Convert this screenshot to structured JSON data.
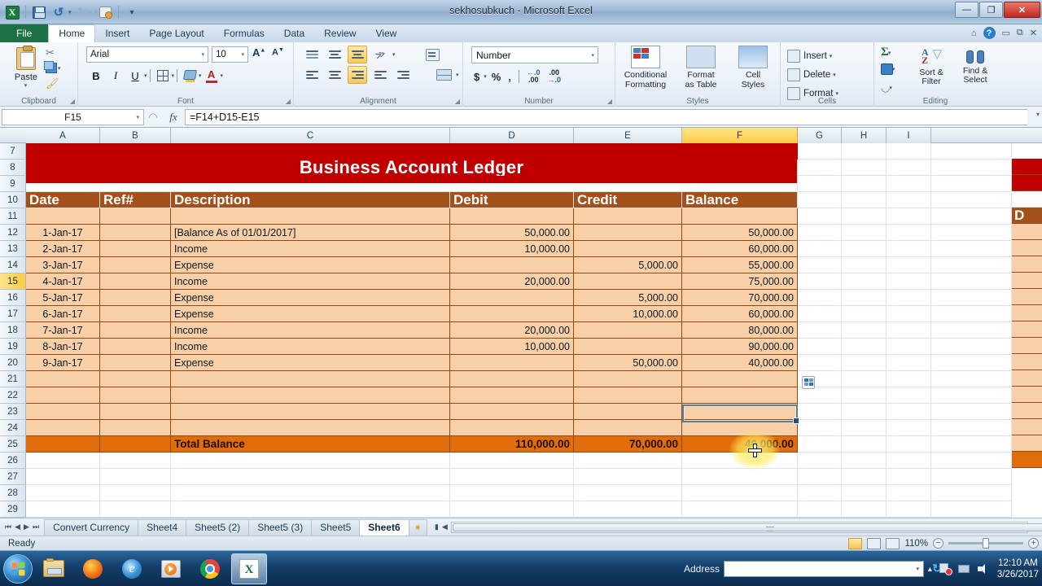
{
  "window": {
    "title": "sekhosubkuch - Microsoft Excel",
    "minimize": "—",
    "maximize": "❐",
    "close": "✕"
  },
  "quick_access": {
    "excel_logo": "X",
    "save": "save-icon",
    "undo": "↺",
    "redo": "↻",
    "print_preview": "print-preview-icon",
    "customize": "▾"
  },
  "ribbon": {
    "tabs": [
      {
        "label": "File",
        "active": false
      },
      {
        "label": "Home",
        "active": true
      },
      {
        "label": "Insert",
        "active": false
      },
      {
        "label": "Page Layout",
        "active": false
      },
      {
        "label": "Formulas",
        "active": false
      },
      {
        "label": "Data",
        "active": false
      },
      {
        "label": "Review",
        "active": false
      },
      {
        "label": "View",
        "active": false
      }
    ],
    "help_cluster": {
      "minimize_ribbon": "⌂",
      "help": "?",
      "restore_down": "▭",
      "window": "⧉",
      "close": "✕"
    },
    "groups": {
      "clipboard": {
        "label": "Clipboard",
        "paste": "Paste",
        "paste_caret": "▾",
        "cut": "✂",
        "copy": "copy-icon",
        "format_painter": "format-painter-icon",
        "dialog_launcher": "◢"
      },
      "font": {
        "label": "Font",
        "font_name": "Arial",
        "font_size": "10",
        "grow_font": "A",
        "shrink_font": "A",
        "bold": "B",
        "italic": "I",
        "underline": "U",
        "borders": "borders-icon",
        "fill_color": "fill-color-icon",
        "font_color": "A",
        "caret": "▾",
        "dialog_launcher": "◢"
      },
      "alignment": {
        "label": "Alignment",
        "top_align": "top-align-icon",
        "middle_align": "middle-align-icon",
        "bottom_align": "bottom-align-icon",
        "orientation": "orientation-icon",
        "align_left": "align-left-icon",
        "align_center": "align-center-icon",
        "align_right": "align-right-icon",
        "decrease_indent": "decrease-indent-icon",
        "increase_indent": "increase-indent-icon",
        "wrap_text": "wrap-text-icon",
        "merge_center": "merge-center-icon",
        "caret": "▾",
        "dialog_launcher": "◢"
      },
      "number": {
        "label": "Number",
        "format": "Number",
        "accounting": "$",
        "percent": "%",
        "comma": ",",
        "increase_decimal": ".00",
        "decrease_decimal": ".00",
        "caret": "▾",
        "dialog_launcher": "◢"
      },
      "styles": {
        "label": "Styles",
        "conditional_formatting": "Conditional\nFormatting",
        "conditional_formatting_l1": "Conditional",
        "conditional_formatting_l2": "Formatting",
        "format_as_table_l1": "Format",
        "format_as_table_l2": "as Table",
        "cell_styles_l1": "Cell",
        "cell_styles_l2": "Styles",
        "caret": "▾"
      },
      "cells": {
        "label": "Cells",
        "insert": "Insert",
        "delete": "Delete",
        "format": "Format",
        "caret": "▾"
      },
      "editing": {
        "label": "Editing",
        "autosum": "Σ",
        "fill": "fill-icon",
        "clear": "clear-icon",
        "sort_filter_l1": "Sort &",
        "sort_filter_l2": "Filter",
        "find_select_l1": "Find &",
        "find_select_l2": "Select",
        "caret": "▾"
      }
    }
  },
  "formula_bar": {
    "name_box": "F15",
    "name_box_caret": "▾",
    "cancel": "✕",
    "enter": "✓",
    "insert_function": "fx",
    "formula": "=F14+D15-E15",
    "expand_caret": "▾"
  },
  "grid": {
    "columns": [
      "A",
      "B",
      "C",
      "D",
      "E",
      "F",
      "G",
      "H",
      "I"
    ],
    "selected_column": "F",
    "rows": [
      "7",
      "8",
      "9",
      "10",
      "11",
      "12",
      "13",
      "14",
      "15",
      "16",
      "17",
      "18",
      "19",
      "20",
      "21",
      "22",
      "23",
      "24",
      "25",
      "26",
      "27",
      "28",
      "29"
    ],
    "selected_row": "15",
    "selected_cell": "F15",
    "paste_options_icon": "paste-options-icon",
    "ledger_title": "Business Account Ledger",
    "headers": [
      "Date",
      "Ref#",
      "Description",
      "Debit",
      "Credit",
      "Balance"
    ],
    "entries": [
      {
        "row": "12",
        "date": "1-Jan-17",
        "ref": "",
        "description": "[Balance As of 01/01/2017]",
        "debit": "50,000.00",
        "credit": "",
        "balance": "50,000.00"
      },
      {
        "row": "13",
        "date": "2-Jan-17",
        "ref": "",
        "description": "Income",
        "debit": "10,000.00",
        "credit": "",
        "balance": "60,000.00"
      },
      {
        "row": "14",
        "date": "3-Jan-17",
        "ref": "",
        "description": "Expense",
        "debit": "",
        "credit": "5,000.00",
        "balance": "55,000.00"
      },
      {
        "row": "15",
        "date": "4-Jan-17",
        "ref": "",
        "description": "Income",
        "debit": "20,000.00",
        "credit": "",
        "balance": "75,000.00"
      },
      {
        "row": "16",
        "date": "5-Jan-17",
        "ref": "",
        "description": "Expense",
        "debit": "",
        "credit": "5,000.00",
        "balance": "70,000.00"
      },
      {
        "row": "17",
        "date": "6-Jan-17",
        "ref": "",
        "description": "Expense",
        "debit": "",
        "credit": "10,000.00",
        "balance": "60,000.00"
      },
      {
        "row": "18",
        "date": "7-Jan-17",
        "ref": "",
        "description": "Income",
        "debit": "20,000.00",
        "credit": "",
        "balance": "80,000.00"
      },
      {
        "row": "19",
        "date": "8-Jan-17",
        "ref": "",
        "description": "Income",
        "debit": "10,000.00",
        "credit": "",
        "balance": "90,000.00"
      },
      {
        "row": "20",
        "date": "9-Jan-17",
        "ref": "",
        "description": "Expense",
        "debit": "",
        "credit": "50,000.00",
        "balance": "40,000.00"
      },
      {
        "row": "21",
        "date": "",
        "ref": "",
        "description": "",
        "debit": "",
        "credit": "",
        "balance": ""
      },
      {
        "row": "22",
        "date": "",
        "ref": "",
        "description": "",
        "debit": "",
        "credit": "",
        "balance": ""
      },
      {
        "row": "23",
        "date": "",
        "ref": "",
        "description": "",
        "debit": "",
        "credit": "",
        "balance": ""
      },
      {
        "row": "24",
        "date": "",
        "ref": "",
        "description": "",
        "debit": "",
        "credit": "",
        "balance": ""
      }
    ],
    "total": {
      "row": "25",
      "label": "Total Balance",
      "debit": "110,000.00",
      "credit": "70,000.00",
      "balance": "40,000.00"
    }
  },
  "sheet_tabs": {
    "nav": {
      "first": "⏮",
      "prev": "◀",
      "next": "▶",
      "last": "⏭"
    },
    "tabs": [
      {
        "label": "Convert Currency",
        "active": false
      },
      {
        "label": "Sheet4",
        "active": false
      },
      {
        "label": "Sheet5 (2)",
        "active": false
      },
      {
        "label": "Sheet5 (3)",
        "active": false
      },
      {
        "label": "Sheet5",
        "active": false
      },
      {
        "label": "Sheet6",
        "active": true
      }
    ],
    "insert_sheet": "insert-worksheet-icon"
  },
  "status_bar": {
    "mode": "Ready",
    "view_normal": "normal-view-icon",
    "view_page_layout": "page-layout-view-icon",
    "view_page_break": "page-break-view-icon",
    "zoom": "110%",
    "zoom_out": "−",
    "zoom_in": "+"
  },
  "taskbar": {
    "start": "start-orb",
    "pinned": [
      {
        "name": "windows-explorer-icon"
      },
      {
        "name": "firefox-icon"
      },
      {
        "name": "internet-explorer-icon"
      },
      {
        "name": "windows-media-player-icon"
      },
      {
        "name": "google-chrome-icon"
      },
      {
        "name": "excel-icon",
        "active": true
      }
    ],
    "address_label": "Address",
    "address_value": "",
    "address_caret": "▾",
    "go_icon": "↻",
    "tray_expand": "▲",
    "clock_time": "12:10 AM",
    "clock_date": "3/26/2017"
  },
  "colors": {
    "ledger_title_bg": "#C00000",
    "ledger_header_bg": "#A3501A",
    "ledger_row_bg": "#F8CFA6",
    "ledger_total_bg": "#E36C0A",
    "selection_border": "#5B7C9E",
    "selected_header": "#FFCB45",
    "excel_green": "#1E7145"
  }
}
